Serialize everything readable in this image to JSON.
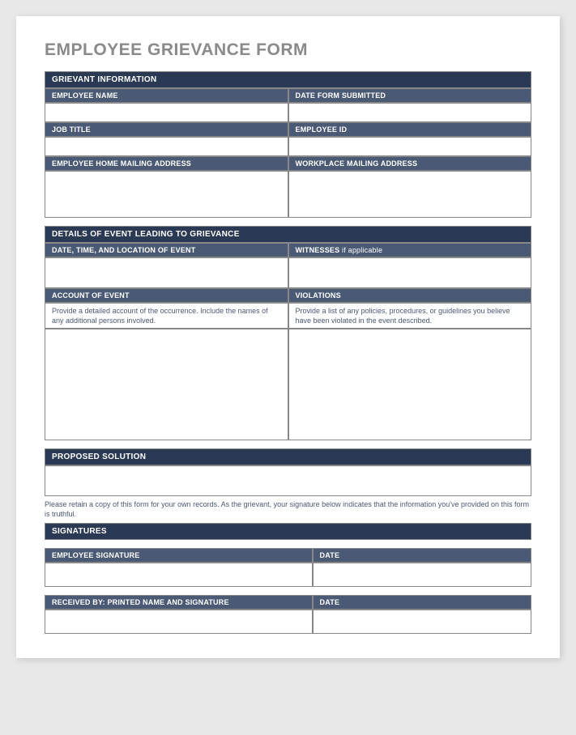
{
  "title": "EMPLOYEE GRIEVANCE FORM",
  "sections": {
    "grievant_info": {
      "header": "GRIEVANT INFORMATION",
      "employee_name_label": "EMPLOYEE NAME",
      "date_submitted_label": "DATE FORM SUBMITTED",
      "job_title_label": "JOB TITLE",
      "employee_id_label": "EMPLOYEE ID",
      "home_address_label": "EMPLOYEE HOME MAILING ADDRESS",
      "workplace_address_label": "WORKPLACE MAILING ADDRESS"
    },
    "event_details": {
      "header": "DETAILS OF EVENT LEADING TO GRIEVANCE",
      "date_time_location_label": "DATE, TIME, AND LOCATION OF EVENT",
      "witnesses_label": "WITNESSES",
      "witnesses_note": " if applicable",
      "account_label": "ACCOUNT OF EVENT",
      "account_instruction": "Provide a detailed account of the occurrence. Include the names of any additional persons involved.",
      "violations_label": "VIOLATIONS",
      "violations_instruction": "Provide a list of any policies, procedures, or guidelines you believe have been violated in the event described."
    },
    "proposed_solution": {
      "header": "PROPOSED SOLUTION"
    },
    "disclaimer": "Please retain a copy of this form for your own records.  As the grievant, your signature below indicates that the information you've provided on this form is truthful.",
    "signatures": {
      "header": "SIGNATURES",
      "employee_signature_label": "EMPLOYEE SIGNATURE",
      "date_label": "DATE",
      "received_by_label": "RECEIVED BY: PRINTED NAME AND SIGNATURE",
      "date_label_2": "DATE"
    }
  }
}
